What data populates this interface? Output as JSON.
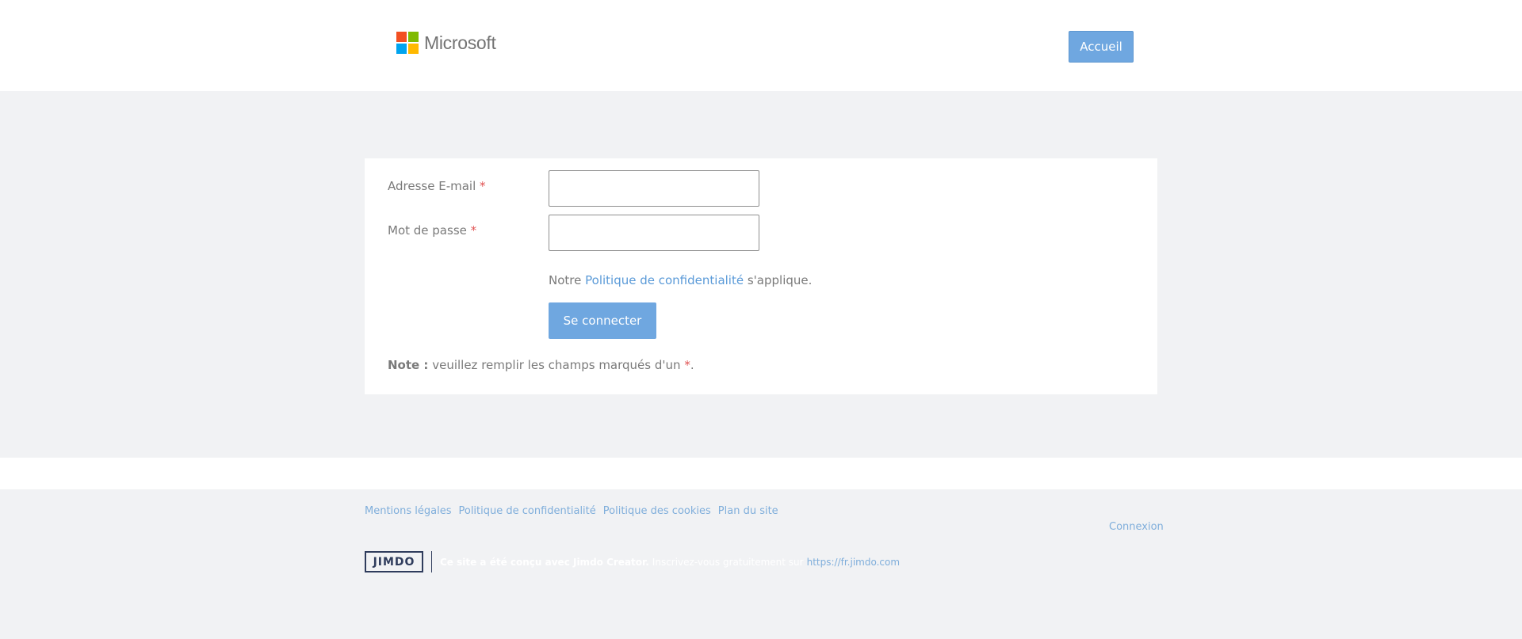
{
  "header": {
    "logo_text": "Microsoft",
    "logo_colors": [
      "#f25022",
      "#7fba00",
      "#00a4ef",
      "#ffb900"
    ],
    "home_button": "Accueil"
  },
  "form": {
    "email_label": "Adresse E-mail",
    "password_label": "Mot de passe",
    "required_mark": "*",
    "email_value": "",
    "password_value": "",
    "policy_prefix": "Notre",
    "policy_link": "Politique de confidentialité",
    "policy_suffix": "s'applique.",
    "submit": "Se connecter",
    "note_label": "Note :",
    "note_text": "veuillez remplir les champs marqués d'un",
    "note_mark": "*",
    "note_end": "."
  },
  "footer": {
    "links": [
      "Mentions légales",
      "Politique de confidentialité",
      "Politique des cookies",
      "Plan du site"
    ],
    "login": "Connexion",
    "jimdo_logo": "JIMDO",
    "made_with": "Ce site a été conçu avec Jimdo Creator.",
    "signup": "Inscrivez-vous gratuitement sur",
    "jimdo_url": "https://fr.jimdo.com"
  },
  "colors": {
    "accent": "#6fa7e0",
    "required": "#e05252",
    "link": "#5a9ad8",
    "background": "#f1f2f4"
  }
}
